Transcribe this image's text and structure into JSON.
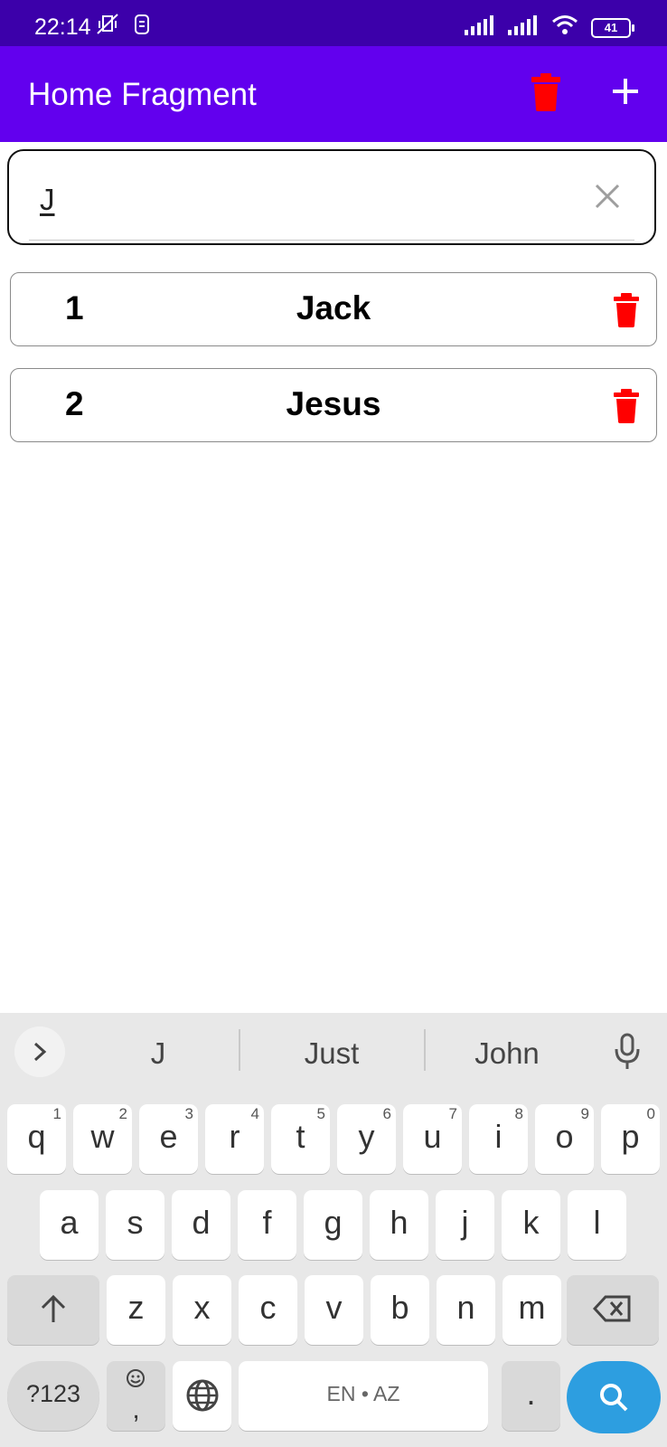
{
  "status_bar": {
    "time": "22:14",
    "battery": "41"
  },
  "app_bar": {
    "title": "Home Fragment"
  },
  "search": {
    "value": "J"
  },
  "list": [
    {
      "number": "1",
      "name": "Jack"
    },
    {
      "number": "2",
      "name": "Jesus"
    }
  ],
  "keyboard": {
    "suggestions": [
      "J",
      "Just",
      "John"
    ],
    "row1": [
      {
        "k": "q",
        "n": "1"
      },
      {
        "k": "w",
        "n": "2"
      },
      {
        "k": "e",
        "n": "3"
      },
      {
        "k": "r",
        "n": "4"
      },
      {
        "k": "t",
        "n": "5"
      },
      {
        "k": "y",
        "n": "6"
      },
      {
        "k": "u",
        "n": "7"
      },
      {
        "k": "i",
        "n": "8"
      },
      {
        "k": "o",
        "n": "9"
      },
      {
        "k": "p",
        "n": "0"
      }
    ],
    "row2": [
      "a",
      "s",
      "d",
      "f",
      "g",
      "h",
      "j",
      "k",
      "l"
    ],
    "row3": [
      "z",
      "x",
      "c",
      "v",
      "b",
      "n",
      "m"
    ],
    "symbols_label": "?123",
    "comma_label": ",",
    "space_label": "EN • AZ",
    "period_label": "."
  },
  "colors": {
    "status_bar": "#3c00aa",
    "app_bar": "#6200ee",
    "delete_red": "#ff0000",
    "search_key": "#2d9ee0"
  }
}
